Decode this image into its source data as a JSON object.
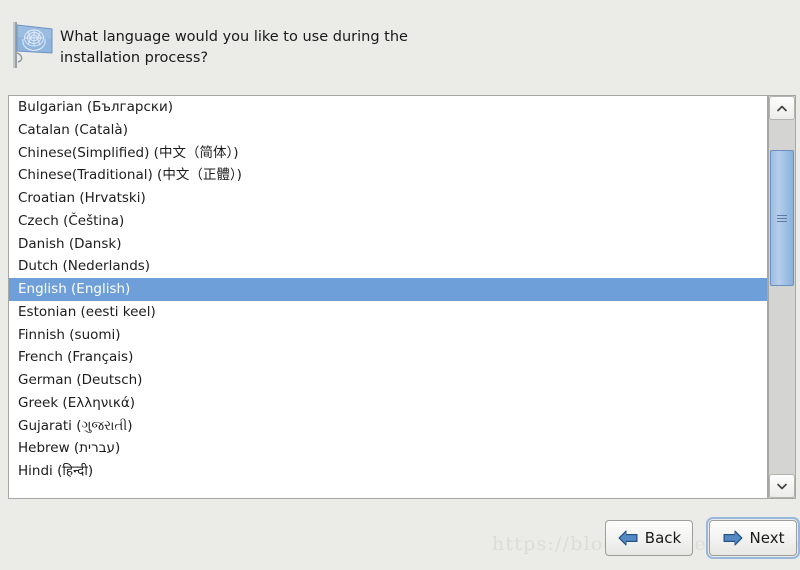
{
  "header": {
    "icon": "un-flag-icon",
    "line1": "What language would you like to use during the",
    "line2": "installation process?"
  },
  "language_list": {
    "selected": "English (English)",
    "items": [
      "Bulgarian (Български)",
      "Catalan (Català)",
      "Chinese(Simplified) (中文（简体）)",
      "Chinese(Traditional) (中文（正體）)",
      "Croatian (Hrvatski)",
      "Czech (Čeština)",
      "Danish (Dansk)",
      "Dutch (Nederlands)",
      "English (English)",
      "Estonian (eesti keel)",
      "Finnish (suomi)",
      "French (Français)",
      "German (Deutsch)",
      "Greek (Ελληνικά)",
      "Gujarati (ગુજરાતી)",
      "Hebrew (עברית)",
      "Hindi (हिन्दी)"
    ]
  },
  "scrollbar": {
    "up_icon": "chevron-up-icon",
    "down_icon": "chevron-down-icon",
    "thumb": "scrollbar-thumb"
  },
  "buttons": {
    "back": {
      "label": "Back",
      "icon": "arrow-left-icon"
    },
    "next": {
      "label": "Next",
      "icon": "arrow-right-icon"
    }
  },
  "watermark": "https://blog.csdn.net/akangwu",
  "colors": {
    "background": "#ebebe8",
    "list_background": "#ffffff",
    "selection": "#6f9fd8",
    "selection_text": "#ffffff",
    "border": "#a6a6a3",
    "accent_blue": "#3a6fb0",
    "focus_ring": "#9ab6dd"
  }
}
